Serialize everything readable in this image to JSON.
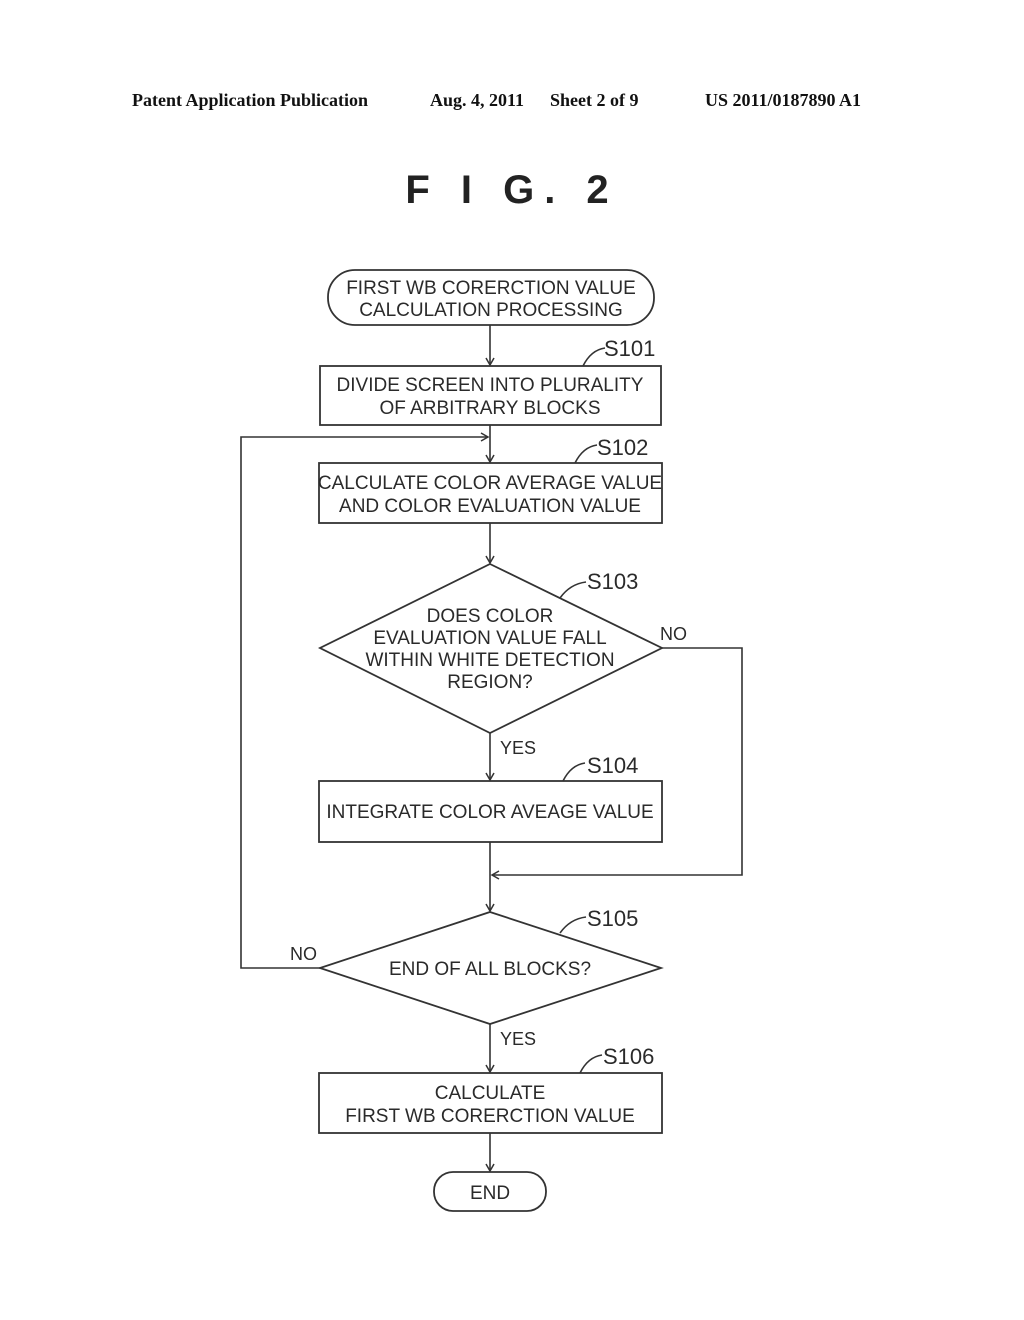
{
  "header": {
    "publication": "Patent Application Publication",
    "date": "Aug. 4, 2011",
    "sheet": "Sheet 2 of 9",
    "number": "US 2011/0187890 A1"
  },
  "figure_title": "F I G. 2",
  "flowchart": {
    "start": {
      "line1": "FIRST WB CORERCTION VALUE",
      "line2": "CALCULATION PROCESSING"
    },
    "s101": {
      "label": "S101",
      "line1": "DIVIDE SCREEN INTO PLURALITY",
      "line2": "OF ARBITRARY BLOCKS"
    },
    "s102": {
      "label": "S102",
      "line1": "CALCULATE COLOR AVERAGE VALUE",
      "line2": "AND COLOR EVALUATION VALUE"
    },
    "s103": {
      "label": "S103",
      "line1": "DOES COLOR",
      "line2": "EVALUATION VALUE FALL",
      "line3": "WITHIN WHITE DETECTION",
      "line4": "REGION?",
      "yes": "YES",
      "no": "NO"
    },
    "s104": {
      "label": "S104",
      "line1": "INTEGRATE COLOR AVEAGE VALUE"
    },
    "s105": {
      "label": "S105",
      "line1": "END OF ALL BLOCKS?",
      "yes": "YES",
      "no": "NO"
    },
    "s106": {
      "label": "S106",
      "line1": "CALCULATE",
      "line2": "FIRST WB CORERCTION VALUE"
    },
    "end": {
      "line1": "END"
    }
  }
}
